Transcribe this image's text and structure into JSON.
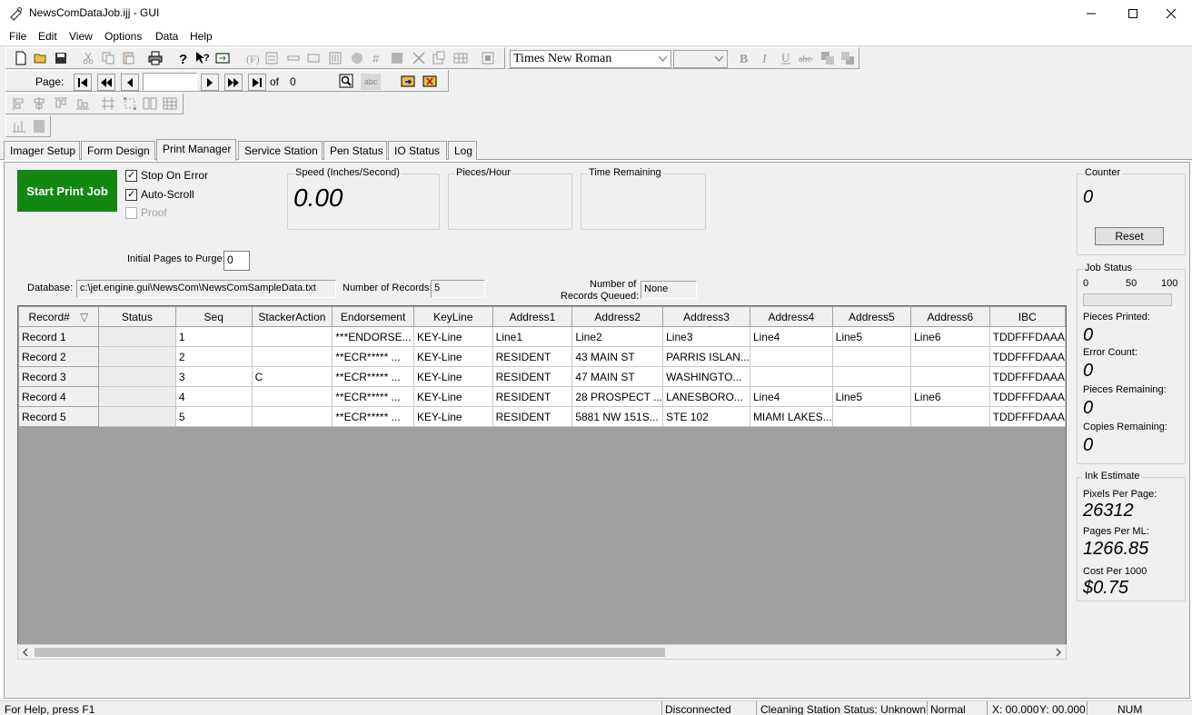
{
  "window": {
    "title": "NewsComDataJob.ijj - GUI",
    "minimize": "—",
    "maximize": "☐",
    "close": "✕"
  },
  "menu": [
    "File",
    "Edit",
    "View",
    "Options",
    "Data",
    "Help"
  ],
  "toolbar": {
    "font_name": "Times New Roman",
    "font_size": "",
    "page_label": "Page:",
    "page_value": "",
    "of_label": "of",
    "page_total": "0",
    "abc_label": "abc"
  },
  "tabs": [
    "Imager Setup",
    "Form Design",
    "Print Manager",
    "Service Station",
    "Pen Status",
    "IO Status",
    "Log"
  ],
  "active_tab": "Print Manager",
  "print_manager": {
    "start_button": "Start Print Job",
    "stop_on_error": "Stop On Error",
    "auto_scroll": "Auto-Scroll",
    "proof": "Proof",
    "speed_label": "Speed (Inches/Second)",
    "speed_value": "0.00",
    "pieces_hour_label": "Pieces/Hour",
    "time_remaining_label": "Time Remaining",
    "initial_purge_label": "Initial Pages to Purge:",
    "initial_purge_value": "0",
    "database_label": "Database:",
    "database_value": "c:\\jet.engine.gui\\NewsCom\\NewsComSampleData.txt",
    "num_records_label": "Number of Records:",
    "num_records_value": "5",
    "records_queued_label_1": "Number of",
    "records_queued_label_2": "Records Queued:",
    "records_queued_value": "None"
  },
  "grid": {
    "columns": [
      "Record#",
      "Status",
      "Seq",
      "StackerAction",
      "Endorsement",
      "KeyLine",
      "Address1",
      "Address2",
      "Address3",
      "Address4",
      "Address5",
      "Address6",
      "IBC"
    ],
    "sort_glyph": "▽",
    "rows": [
      [
        "Record 1",
        "",
        "1",
        "",
        "***ENDORSE...",
        "KEY-Line",
        "Line1",
        "Line2",
        "Line3",
        "Line4",
        "Line5",
        "Line6",
        "TDDFFFDAAA"
      ],
      [
        "Record 2",
        "",
        "2",
        "",
        "**ECR*****      ...",
        "KEY-Line",
        "RESIDENT",
        "43 MAIN ST",
        "PARRIS ISLAN...",
        "",
        "",
        "",
        "TDDFFFDAAA"
      ],
      [
        "Record 3",
        "",
        "3",
        "C",
        "**ECR*****      ...",
        "KEY-Line",
        "RESIDENT",
        "47 MAIN ST",
        "WASHINGTO...",
        "",
        "",
        "",
        "TDDFFFDAAA"
      ],
      [
        "Record 4",
        "",
        "4",
        "",
        "**ECR*****      ...",
        "KEY-Line",
        "RESIDENT",
        "28 PROSPECT ...",
        "LANESBORO...",
        "Line4",
        "Line5",
        "Line6",
        "TDDFFFDAAA"
      ],
      [
        "Record 5",
        "",
        "5",
        "",
        "**ECR*****      ...",
        "KEY-Line",
        "RESIDENT",
        "5881 NW 151S...",
        "STE 102",
        "MIAMI LAKES...",
        "",
        "",
        "TDDFFFDAAA"
      ]
    ]
  },
  "counter": {
    "label": "Counter",
    "value": "0",
    "reset": "Reset"
  },
  "job_status": {
    "label": "Job Status",
    "scale": [
      "0",
      "50",
      "100"
    ],
    "progress_percent": 0,
    "pieces_printed_label": "Pieces Printed:",
    "pieces_printed": "0",
    "error_count_label": "Error Count:",
    "error_count": "0",
    "pieces_remaining_label": "Pieces Remaining:",
    "pieces_remaining": "0",
    "copies_remaining_label": "Copies Remaining:",
    "copies_remaining": "0"
  },
  "ink": {
    "label": "Ink Estimate",
    "pixels_label": "Pixels Per Page:",
    "pixels_value": "26312",
    "pages_label": "Pages Per ML:",
    "pages_value": "1266.85",
    "cost_label": "Cost Per 1000",
    "cost_value": "$0.75"
  },
  "status_bar": {
    "help": "For Help, press F1",
    "connection": "Disconnected",
    "cleaning": "Cleaning Station Status: Unknown",
    "mode": "Normal",
    "x": "X: 00.000",
    "y": "Y: 00.000",
    "num": "NUM"
  },
  "colors": {
    "start_button": "#128712",
    "chrome": "#f0f0f0",
    "grid_empty": "#a0a0a0"
  }
}
